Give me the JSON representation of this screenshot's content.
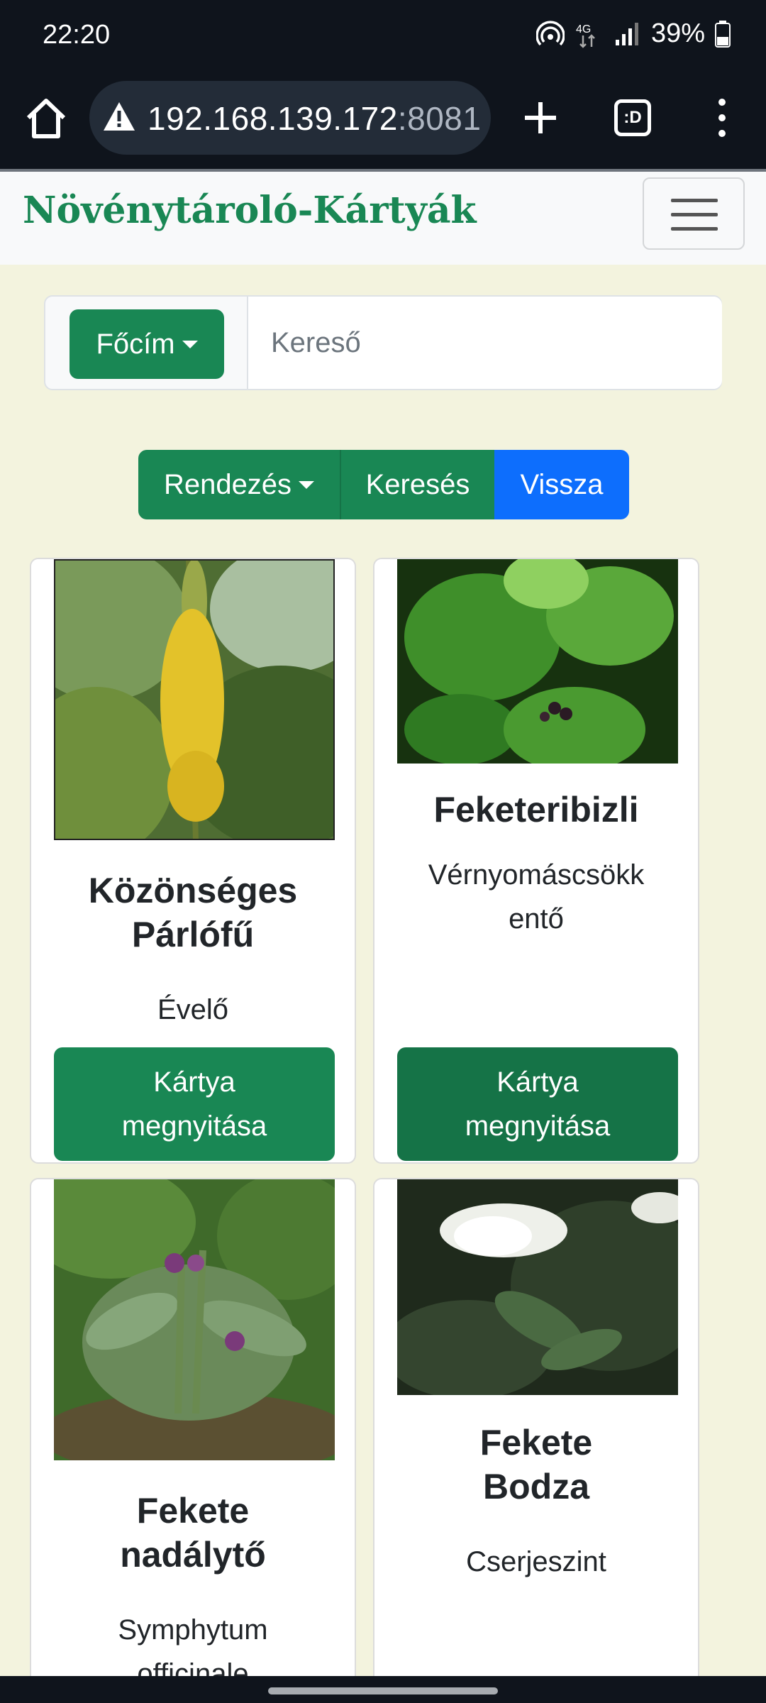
{
  "status_bar": {
    "time": "22:20",
    "battery": "39%",
    "network": "4G"
  },
  "browser": {
    "url_host": "192.168.139.172",
    "url_port": ":8081",
    "tabs_label": ":D"
  },
  "navbar": {
    "brand": "Növénytároló-Kártyák"
  },
  "search": {
    "dropdown_label": "Főcím",
    "placeholder": "Kereső"
  },
  "actions": {
    "sort_label": "Rendezés",
    "search_label": "Keresés",
    "back_label": "Vissza"
  },
  "cards": [
    {
      "title": "Közönséges Párlófű",
      "subtitle": "Évelő",
      "button": "Kártya megnyitása"
    },
    {
      "title": "Feketeribizli",
      "subtitle": "Vérnyomáscsökkentő",
      "button": "Kártya megnyitása"
    },
    {
      "title": "Fekete nadálytő",
      "subtitle": "Symphytum officinale",
      "button": ""
    },
    {
      "title": "Fekete Bodza",
      "subtitle": "Cserjeszint",
      "button": ""
    }
  ],
  "colors": {
    "primary_green": "#198754",
    "blue": "#0d6efd",
    "page_bg": "#f3f3de"
  }
}
